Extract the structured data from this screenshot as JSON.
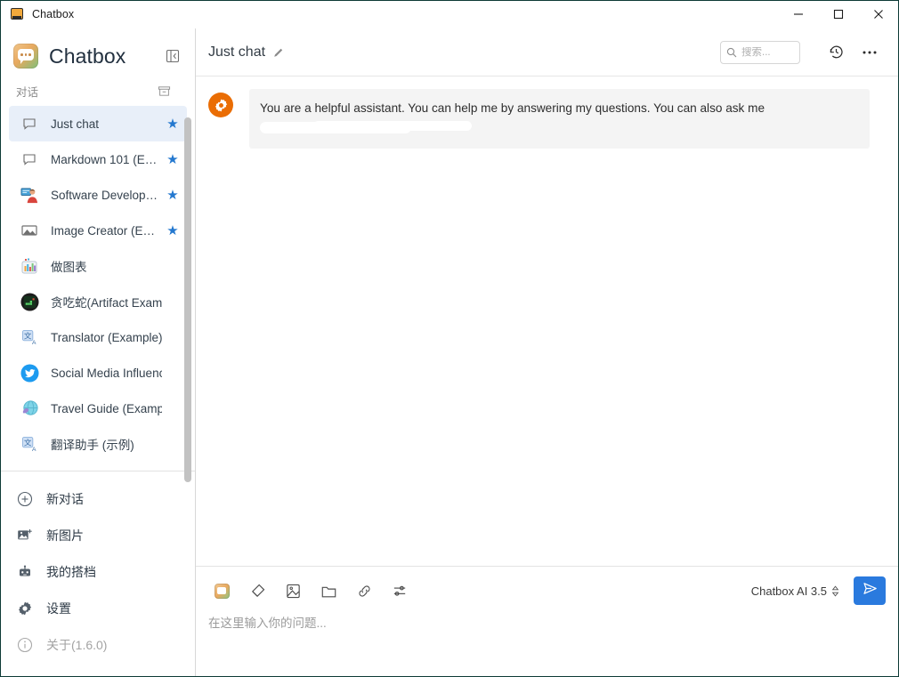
{
  "window": {
    "title": "Chatbox",
    "app_icon": "chatbox-app-icon",
    "minimize_label": "Minimize",
    "maximize_label": "Maximize",
    "close_label": "Close"
  },
  "sidebar": {
    "brand_name": "Chatbox",
    "brand_logo_icon": "chatbox-logo-icon",
    "collapse_label": "Collapse sidebar",
    "section": {
      "label": "对话",
      "archive_icon": "archive-box-icon"
    },
    "chats": [
      {
        "name": "Just chat",
        "icon": "chat-bubble-icon",
        "starred": true,
        "active": true
      },
      {
        "name": "Markdown 101 (E…",
        "icon": "chat-bubble-icon",
        "starred": true,
        "active": false
      },
      {
        "name": "Software Develop…",
        "icon": "developer-avatar",
        "starred": true,
        "active": false
      },
      {
        "name": "Image Creator (E…",
        "icon": "picture-icon",
        "starred": true,
        "active": false
      },
      {
        "name": "做图表",
        "icon": "bar-chart-avatar",
        "starred": false,
        "active": false
      },
      {
        "name": "贪吃蛇(Artifact Example)",
        "icon": "snake-game-avatar",
        "starred": false,
        "active": false
      },
      {
        "name": "Translator (Example)",
        "icon": "translate-avatar",
        "starred": false,
        "active": false
      },
      {
        "name": "Social Media Influence…",
        "icon": "twitter-avatar",
        "starred": false,
        "active": false
      },
      {
        "name": "Travel Guide (Example)",
        "icon": "globe-avatar",
        "starred": false,
        "active": false
      },
      {
        "name": "翻译助手 (示例)",
        "icon": "translate-avatar",
        "starred": false,
        "active": false
      }
    ],
    "nav": [
      {
        "label": "新对话",
        "icon": "plus-circle-icon",
        "muted": false
      },
      {
        "label": "新图片",
        "icon": "add-image-icon",
        "muted": false
      },
      {
        "label": "我的搭档",
        "icon": "robot-icon",
        "muted": false
      },
      {
        "label": "设置",
        "icon": "gear-icon",
        "muted": false
      },
      {
        "label": "关于(1.6.0)",
        "icon": "info-circle-icon",
        "muted": true
      }
    ]
  },
  "header": {
    "title": "Just chat",
    "edit_icon": "pencil-icon",
    "search": {
      "placeholder": "搜索...",
      "value": "",
      "icon": "search-icon"
    },
    "history_icon": "history-clock-icon",
    "more_icon": "more-horizontal-icon"
  },
  "conversation": {
    "messages": [
      {
        "role": "system",
        "avatar_icon": "gear-icon",
        "text": "You are a helpful assistant. You can help me by answering my questions. You can also ask me",
        "redacted_second_line": true
      }
    ]
  },
  "composer": {
    "tools": [
      {
        "icon": "chatbox-logo-icon",
        "label": "Chatbox"
      },
      {
        "icon": "eraser-icon",
        "label": "Clear"
      },
      {
        "icon": "image-icon",
        "label": "Insert image"
      },
      {
        "icon": "folder-icon",
        "label": "Attach file"
      },
      {
        "icon": "link-icon",
        "label": "Insert link"
      },
      {
        "icon": "sliders-icon",
        "label": "Settings"
      }
    ],
    "model_label": "Chatbox AI 3.5",
    "model_caret_icon": "chevron-updown-icon",
    "send_icon": "send-paper-plane-icon",
    "input_placeholder": "在这里输入你的问题...",
    "input_value": ""
  },
  "colors": {
    "accent_blue": "#2a7ade",
    "star_blue": "#2478cf",
    "active_item_bg": "#e8eff9",
    "system_avatar_orange": "#ea6d04",
    "bubble_bg": "#f4f4f4",
    "window_border": "#0d3b36"
  }
}
